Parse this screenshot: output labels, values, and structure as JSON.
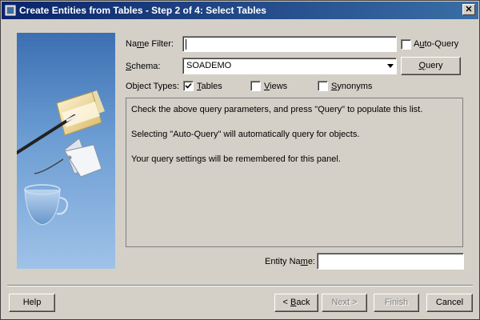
{
  "window": {
    "title": "Create Entities from Tables - Step 2 of 4: Select Tables",
    "close_glyph": "✕"
  },
  "filter": {
    "name_filter_label_pre": "Na",
    "name_filter_label_key": "m",
    "name_filter_label_post": "e Filter:",
    "name_filter_value": "",
    "auto_query_label_pre": "A",
    "auto_query_label_key": "u",
    "auto_query_label_post": "to-Query",
    "auto_query_checked": false
  },
  "schema": {
    "label_key": "S",
    "label_post": "chema:",
    "value": "SOADEMO",
    "query_button_key": "Q",
    "query_button_post": "uery"
  },
  "object_types": {
    "label": "Object Types:",
    "options": [
      {
        "key": "T",
        "post": "ables",
        "checked": true
      },
      {
        "key": "V",
        "post": "iews",
        "checked": false
      },
      {
        "key": "S",
        "post": "ynonyms",
        "checked": false
      }
    ]
  },
  "messages": [
    "Check the above query parameters, and press \"Query\" to populate this list.",
    "Selecting \"Auto-Query\" will automatically query for objects.",
    "Your query settings will be remembered for this panel."
  ],
  "entity_name": {
    "label_pre": "Entity Na",
    "label_key": "m",
    "label_post": "e:",
    "value": ""
  },
  "buttons": {
    "help": "Help",
    "back_pre": "< ",
    "back_key": "B",
    "back_post": "ack",
    "next": "Next >",
    "finish": "Finish",
    "cancel": "Cancel"
  },
  "colors": {
    "titlebar_start": "#0a246a",
    "titlebar_end": "#3a6ea5",
    "dialog_bg": "#d4d0c8",
    "banner_top": "#3b6fb2"
  }
}
